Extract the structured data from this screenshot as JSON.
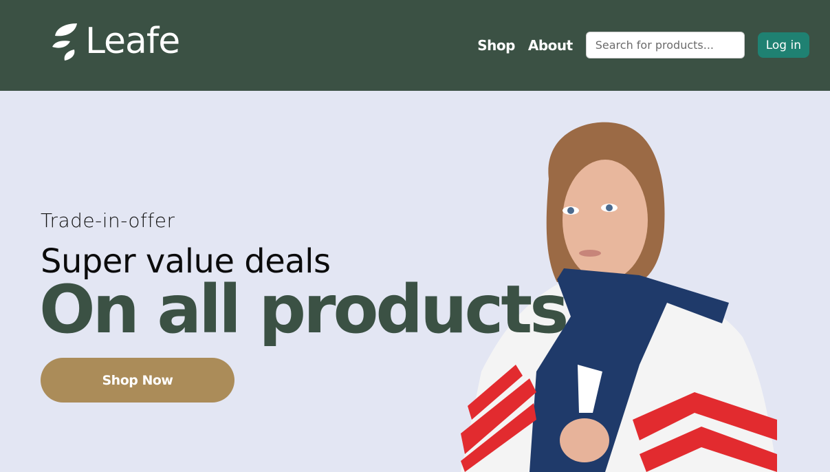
{
  "brand": {
    "name": "Leafe",
    "icon": "leaf-icon"
  },
  "nav": {
    "links": [
      "Shop",
      "About"
    ],
    "search_placeholder": "Search for products...",
    "login_label": "Log in"
  },
  "hero": {
    "tagline": "Trade-in-offer",
    "headline": "Super value deals",
    "headline_big": "On all products",
    "cta_label": "Shop Now"
  },
  "colors": {
    "header_bg": "#3b5144",
    "hero_bg": "#e3e6f3",
    "accent_green": "#3b5144",
    "login_bg": "#1f8172",
    "cta_bg": "#ab8c59"
  }
}
